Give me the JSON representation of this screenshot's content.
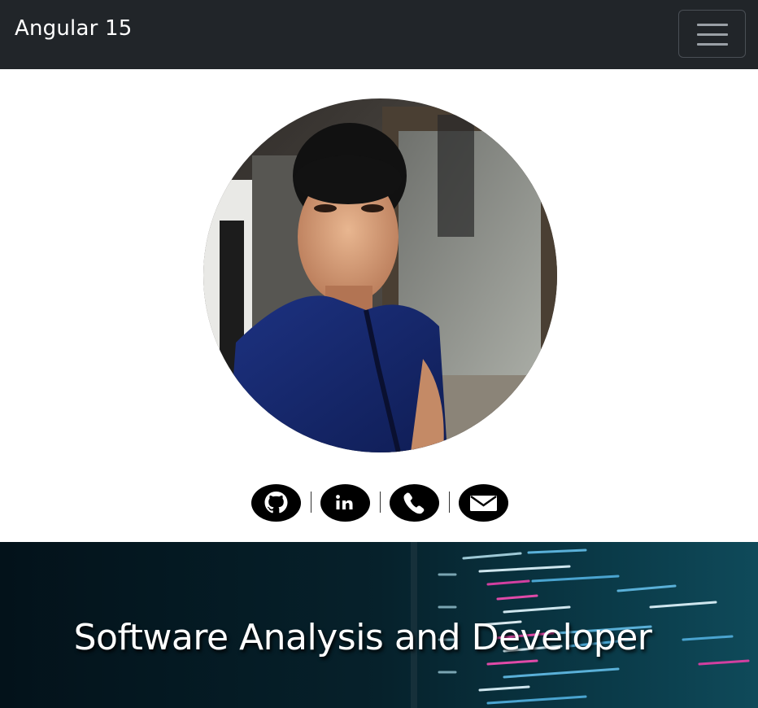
{
  "navbar": {
    "brand": "Angular 15",
    "toggle_aria": "Toggle navigation"
  },
  "profile": {
    "photo_alt": "Profile photo"
  },
  "social": {
    "separator": "|",
    "icons": [
      "github-icon",
      "linkedin-icon",
      "phone-icon",
      "email-icon"
    ]
  },
  "hero": {
    "title": "Software Analysis and Developer"
  },
  "colors": {
    "navbar_bg": "#212529",
    "hero_bg": "#05161d",
    "icon_fill": "#000000"
  }
}
